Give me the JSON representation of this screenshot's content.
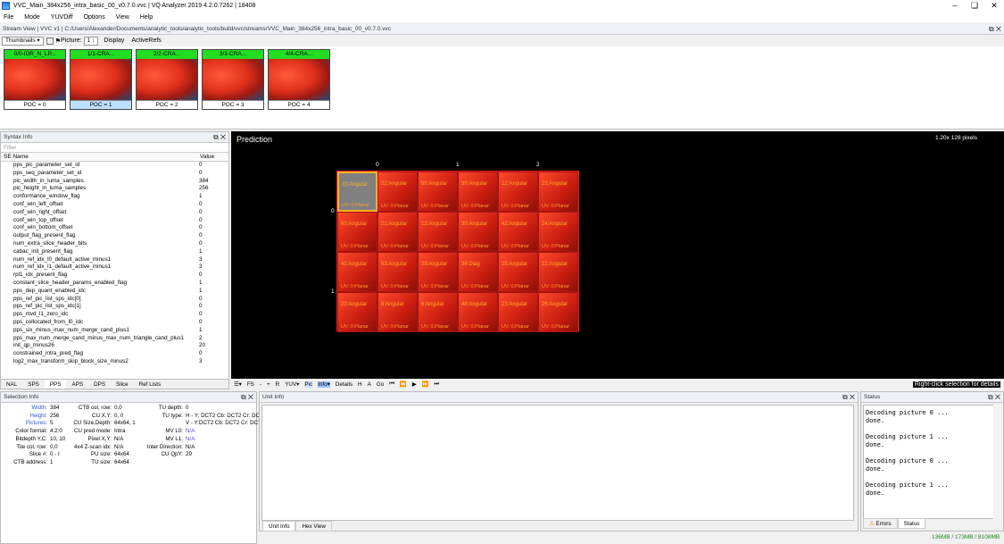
{
  "window": {
    "title": "VVC_Main_384x256_intra_basic_00_v0.7.0.vvc | VQ Analyzer 2019 4.2.0.7262 | 18408"
  },
  "menu": [
    "File",
    "Mode",
    "YUVDiff",
    "Options",
    "View",
    "Help"
  ],
  "stream_view": {
    "header": "Stream View | VVC v1 | C:/Users/Alexander/Documents/analytic_tools/analytic_tools/build/vvc/streams/VVC_Main_384x256_intra_basic_00_v0.7.0.vvc",
    "mode": "Thumbnails",
    "picture_label": "Picture:",
    "picture_value": "1",
    "display_label": "Display",
    "activerefs_label": "ActiveRefs",
    "thumbs": [
      {
        "label": "0/0-IDR_N_LP...",
        "poc": "POC = 0"
      },
      {
        "label": "1/1-CRA...",
        "poc": "POC = 1"
      },
      {
        "label": "2/2-CRA...",
        "poc": "POC = 2"
      },
      {
        "label": "3/3-CRA...",
        "poc": "POC = 3"
      },
      {
        "label": "4/4-CRA...",
        "poc": "POC = 4"
      }
    ]
  },
  "syntax_info": {
    "header": "Syntax Info",
    "filter": "Filter",
    "col_name": "SE Name",
    "col_value": "Value",
    "rows": [
      [
        "pps_pic_parameter_set_id",
        "0"
      ],
      [
        "pps_seq_parameter_set_id",
        "0"
      ],
      [
        "pic_width_in_luma_samples",
        "384"
      ],
      [
        "pic_height_in_luma_samples",
        "256"
      ],
      [
        "conformance_window_flag",
        "1"
      ],
      [
        "conf_win_left_offset",
        "0"
      ],
      [
        "conf_win_right_offset",
        "0"
      ],
      [
        "conf_win_top_offset",
        "0"
      ],
      [
        "conf_win_bottom_offset",
        "0"
      ],
      [
        "output_flag_present_flag",
        "0"
      ],
      [
        "num_extra_slice_header_bits",
        "0"
      ],
      [
        "cabac_init_present_flag",
        "1"
      ],
      [
        "num_ref_idx_l0_default_active_minus1",
        "3"
      ],
      [
        "num_ref_idx_l1_default_active_minus1",
        "3"
      ],
      [
        "rpl1_idx_present_flag",
        "0"
      ],
      [
        "constant_slice_header_params_enabled_flag",
        "1"
      ],
      [
        "pps_dep_quant_enabled_idc",
        "1"
      ],
      [
        "pps_ref_pic_list_sps_idc[0]",
        "0"
      ],
      [
        "pps_ref_pic_list_sps_idc[1]",
        "0"
      ],
      [
        "pps_mvd_l1_zero_idc",
        "0"
      ],
      [
        "pps_collocated_from_l0_idc",
        "0"
      ],
      [
        "pps_six_minus_max_num_merge_cand_plus1",
        "1"
      ],
      [
        "pps_max_num_merge_cand_minus_max_num_triangle_cand_plus1",
        "2"
      ],
      [
        "init_qp_minus26",
        "20"
      ],
      [
        "constrained_intra_pred_flag",
        "0"
      ],
      [
        "log2_max_transform_skip_block_size_minus2",
        "3"
      ]
    ],
    "tabs": [
      "NAL",
      "SPS",
      "PPS",
      "APS",
      "DPS",
      "Slice",
      "Ref Lists"
    ]
  },
  "prediction": {
    "title": "Prediction",
    "zoom": "1.20x 128 pixels",
    "cols": [
      "0",
      "1",
      "2"
    ],
    "rows": [
      "0",
      "1"
    ],
    "cells": [
      [
        "33:Angular",
        "UV: 0:Planar"
      ],
      [
        "22:Angular",
        "UV: 0:Planar"
      ],
      [
        "50:Angular",
        "UV: 0:Planar"
      ],
      [
        "30:Angular",
        "UV: 0:Planar"
      ],
      [
        "12:Angular",
        "UV: 0:Planar"
      ],
      [
        "23:Angular",
        "UV: 0:Planar"
      ],
      [
        "60:Angular",
        "UV: 0:Planar"
      ],
      [
        "21:Angular",
        "UV: 0:Planar"
      ],
      [
        "12:Angular",
        "UV: 0:Planar"
      ],
      [
        "30:Angular",
        "UV: 0:Planar"
      ],
      [
        "42:Angular",
        "UV: 0:Planar"
      ],
      [
        "24:Angular",
        "UV: 0:Planar"
      ],
      [
        "41:Angular",
        "UV: 0:Planar"
      ],
      [
        "53:Angular",
        "UV: 0:Planar"
      ],
      [
        "29:Angular",
        "UV: 0:Planar"
      ],
      [
        "34:Diag",
        "UV: 0:Planar"
      ],
      [
        "25:Angular",
        "UV: 0:Planar"
      ],
      [
        "12:Angular",
        "UV: 0:Planar"
      ],
      [
        "20:Angular",
        "UV: 0:Planar"
      ],
      [
        "8:Angular",
        "UV: 0:Planar"
      ],
      [
        "6:Angular",
        "UV: 0:Planar"
      ],
      [
        "48:Angular",
        "UV: 0:Planar"
      ],
      [
        "23:Angular",
        "UV: 0:Planar"
      ],
      [
        "26:Angular",
        "UV: 0:Planar"
      ]
    ],
    "toolbar": [
      "FS",
      "-",
      "+",
      "R",
      "YUV",
      "Pic",
      "Info",
      "Details",
      "H",
      "A",
      "Go"
    ],
    "hint": "Right-click selection for details"
  },
  "selection_info": {
    "header": "Selection Info",
    "col1": [
      [
        "Width:",
        "384"
      ],
      [
        "Height:",
        "256"
      ],
      [
        "Pictures:",
        "5"
      ],
      [
        "Color format:",
        "4:2:0"
      ],
      [
        "Bitdepth Y,C:",
        "10, 10"
      ],
      [
        "Tile col, row:",
        "0,0"
      ],
      [
        "Slice #:",
        "0 - I"
      ],
      [
        "CTB address:",
        "1"
      ]
    ],
    "col2": [
      [
        "CTB col, row:",
        "0,0"
      ],
      [
        "CU X,Y:",
        "0, 0"
      ],
      [
        "CU Size,Depth:",
        "64x64, 1"
      ],
      [
        "CU pred mode:",
        "Intra"
      ],
      [
        "Pixel X,Y:",
        "N/A"
      ],
      [
        "4x4 Z-scan idx:",
        "N/A"
      ],
      [
        "PU size:",
        "64x64"
      ],
      [
        "TU size:",
        "64x64"
      ]
    ],
    "col3": [
      [
        "TU depth:",
        "0"
      ],
      [
        "TU type:",
        "H - Y: DCT2 Cb: DCT2 Cr: DCT2"
      ],
      [
        "",
        "V - Y:DCT2 Cb: DCT2 Cr: DCT2"
      ],
      [
        "MV L0:",
        "N/A"
      ],
      [
        "MV L1:",
        "N/A"
      ],
      [
        "Inter Direction:",
        "N/A"
      ],
      [
        "CU QpY:",
        "29"
      ]
    ]
  },
  "unit_info": {
    "header": "Unit Info",
    "tabs": [
      "Unit Info",
      "Hex View"
    ]
  },
  "status": {
    "header": "Status",
    "lines": [
      "Decoding picture 0 ...",
      "done.",
      "",
      "Decoding picture 1 ...",
      "done.",
      "",
      "Decoding picture 0 ...",
      "done.",
      "",
      "Decoding picture 1 ...",
      "done."
    ],
    "tabs": [
      "Errors",
      "Status"
    ]
  },
  "memory": "136MB / 173MB / 8108MB"
}
